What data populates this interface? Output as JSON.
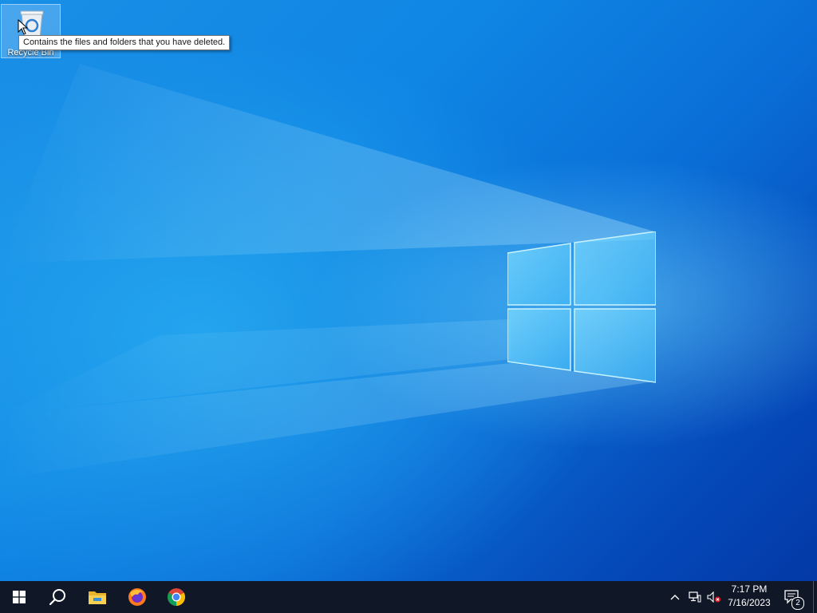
{
  "desktop": {
    "icons": [
      {
        "label": "Recycle Bin",
        "icon": "recycle-bin-icon"
      }
    ],
    "tooltip": "Contains the files and folders that you have deleted."
  },
  "taskbar": {
    "start": {
      "icon": "windows-start-icon"
    },
    "search": {
      "icon": "search-icon"
    },
    "pinned": [
      {
        "name": "File Explorer",
        "icon": "file-explorer-icon"
      },
      {
        "name": "Firefox",
        "icon": "firefox-icon"
      },
      {
        "name": "Chrome",
        "icon": "chrome-icon"
      }
    ],
    "tray": {
      "icons": [
        "chevron-up-icon",
        "network-icon",
        "volume-muted-icon"
      ],
      "time": "7:17 PM",
      "date": "7/16/2023",
      "notifications_count": "2"
    }
  },
  "colors": {
    "taskbar_bg": "#101827",
    "wallpaper_primary": "#0f86e4",
    "wallpaper_dark": "#0339a6",
    "tooltip_bg": "#ffffff"
  }
}
